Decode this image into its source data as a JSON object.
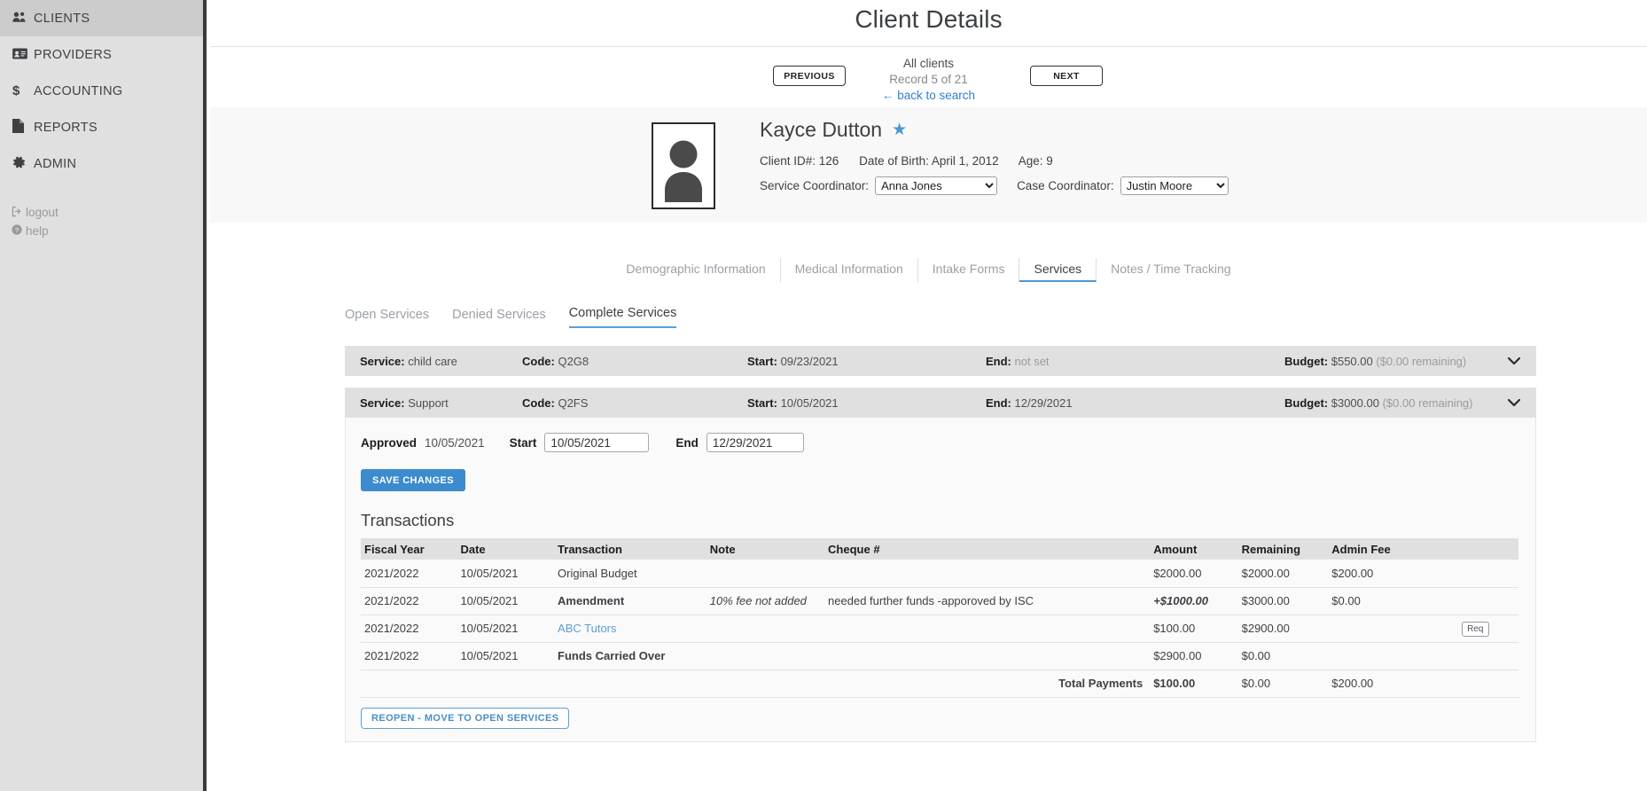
{
  "sidebar": {
    "items": [
      {
        "label": "CLIENTS",
        "icon": "users-icon",
        "glyph": "A",
        "active": true
      },
      {
        "label": "PROVIDERS",
        "icon": "id-card-icon",
        "glyph": "B",
        "active": false
      },
      {
        "label": "ACCOUNTING",
        "icon": "dollar-icon",
        "glyph": "$",
        "active": false
      },
      {
        "label": "REPORTS",
        "icon": "document-icon",
        "glyph": "C",
        "active": false
      },
      {
        "label": "ADMIN",
        "icon": "gear-icon",
        "glyph": "D",
        "active": false
      }
    ],
    "logout": "logout",
    "help": "help"
  },
  "header": {
    "title": "Client Details",
    "previous_label": "PREVIOUS",
    "next_label": "NEXT",
    "scope": "All clients",
    "record_count": "Record 5 of 21",
    "back_link": "← back to search"
  },
  "client": {
    "name": "Kayce Dutton",
    "favorite_star": "★",
    "client_id": "Client ID#: 126",
    "dob": "Date of Birth: April 1, 2012",
    "age": "Age: 9",
    "service_coordinator_label": "Service Coordinator:",
    "service_coordinator_value": "Anna Jones",
    "case_coordinator_label": "Case Coordinator:",
    "case_coordinator_value": "Justin Moore"
  },
  "main_tabs": [
    {
      "label": "Demographic Information",
      "active": false
    },
    {
      "label": "Medical Information",
      "active": false
    },
    {
      "label": "Intake Forms",
      "active": false
    },
    {
      "label": "Services",
      "active": true
    },
    {
      "label": "Notes / Time Tracking",
      "active": false
    }
  ],
  "sub_tabs": [
    {
      "label": "Open Services",
      "active": false
    },
    {
      "label": "Denied Services",
      "active": false
    },
    {
      "label": "Complete Services",
      "active": true
    }
  ],
  "services": [
    {
      "service_label": "Service:",
      "service_value": "child care",
      "code_label": "Code:",
      "code_value": "Q2G8",
      "start_label": "Start:",
      "start_value": "09/23/2021",
      "end_label": "End:",
      "end_value": "not set",
      "end_muted": true,
      "budget_label": "Budget:",
      "budget_value": "$550.00",
      "budget_remaining": "($0.00 remaining)",
      "expanded": false
    },
    {
      "service_label": "Service:",
      "service_value": "Support",
      "code_label": "Code:",
      "code_value": "Q2FS",
      "start_label": "Start:",
      "start_value": "10/05/2021",
      "end_label": "End:",
      "end_value": "12/29/2021",
      "end_muted": false,
      "budget_label": "Budget:",
      "budget_value": "$3000.00",
      "budget_remaining": "($0.00 remaining)",
      "expanded": true
    }
  ],
  "service_detail": {
    "approved_label": "Approved",
    "approved_value": "10/05/2021",
    "start_label": "Start",
    "start_value": "10/05/2021",
    "end_label": "End",
    "end_value": "12/29/2021",
    "save_label": "SAVE CHANGES",
    "reopen_label": "REOPEN - MOVE TO OPEN SERVICES"
  },
  "transactions": {
    "title": "Transactions",
    "columns": [
      "Fiscal Year",
      "Date",
      "Transaction",
      "Note",
      "Cheque #",
      "Amount",
      "Remaining",
      "Admin Fee",
      ""
    ],
    "rows": [
      {
        "fiscal_year": "2021/2022",
        "date": "10/05/2021",
        "transaction": "Original Budget",
        "transaction_bold": false,
        "transaction_link": false,
        "note": "",
        "note_italic": false,
        "cheque": "",
        "amount": "$2000.00",
        "amount_italic": false,
        "remaining": "$2000.00",
        "admin_fee": "$200.00",
        "action": ""
      },
      {
        "fiscal_year": "2021/2022",
        "date": "10/05/2021",
        "transaction": "Amendment",
        "transaction_bold": true,
        "transaction_link": false,
        "note": "10% fee not added",
        "note_italic": true,
        "cheque": "needed further funds -apporoved by ISC",
        "amount": "+$1000.00",
        "amount_italic": true,
        "remaining": "$3000.00",
        "admin_fee": "$0.00",
        "action": ""
      },
      {
        "fiscal_year": "2021/2022",
        "date": "10/05/2021",
        "transaction": "ABC Tutors",
        "transaction_bold": false,
        "transaction_link": true,
        "note": "",
        "note_italic": false,
        "cheque": "",
        "amount": "$100.00",
        "amount_italic": false,
        "remaining": "$2900.00",
        "admin_fee": "",
        "action": "Req"
      },
      {
        "fiscal_year": "2021/2022",
        "date": "10/05/2021",
        "transaction": "Funds Carried Over",
        "transaction_bold": true,
        "transaction_link": false,
        "note": "",
        "note_italic": false,
        "cheque": "",
        "amount": "$2900.00",
        "amount_italic": false,
        "remaining": "$0.00",
        "admin_fee": "",
        "action": ""
      }
    ],
    "total": {
      "label": "Total Payments",
      "amount": "$100.00",
      "remaining": "$0.00",
      "admin_fee": "$200.00"
    }
  },
  "colors": {
    "accent_blue": "#3b8bce",
    "link_blue": "#5f9ed1",
    "sidebar_bg": "#e0e0e0",
    "sidebar_active": "#cccccc",
    "row_header_bg": "#e0e0e0"
  }
}
